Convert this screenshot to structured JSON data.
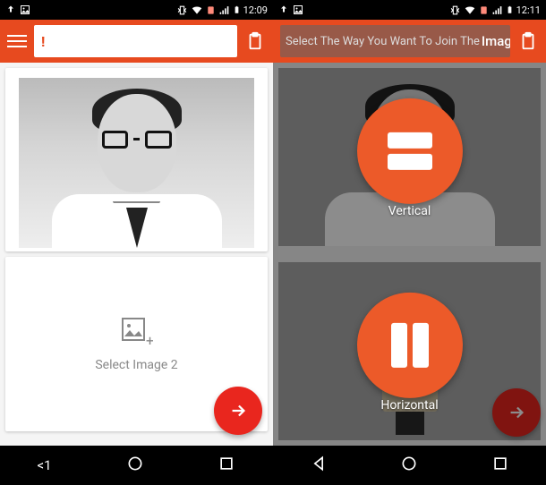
{
  "left": {
    "status": {
      "time": "12:09"
    },
    "header": {
      "search_value": "!"
    },
    "image2_label": "Select Image 2",
    "nav_back_label": "<1"
  },
  "right": {
    "status": {
      "time": "12:11"
    },
    "header": {
      "title_prefix": "Select The Way You Want To Join The",
      "title_emph": "Image"
    },
    "options": {
      "vertical_label": "Vertical",
      "horizontal_label": "Horizontal"
    }
  }
}
